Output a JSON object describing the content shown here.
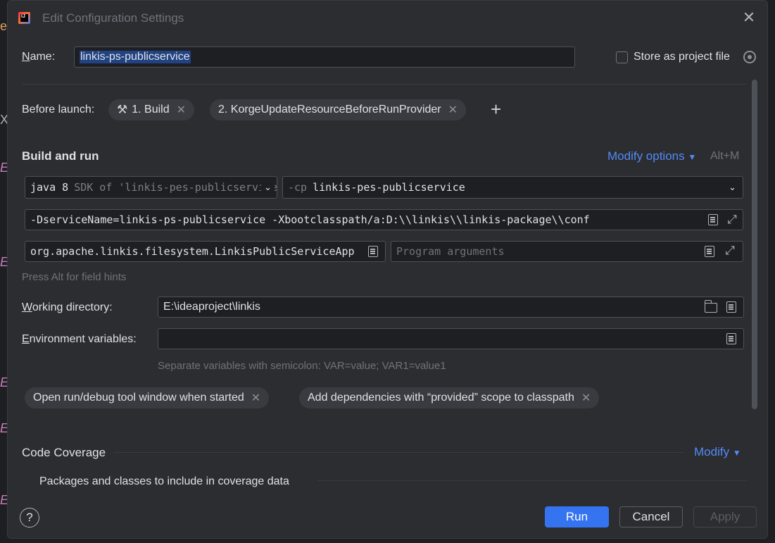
{
  "dialog": {
    "title": "Edit Configuration Settings"
  },
  "name_row": {
    "label": "Name:",
    "value": "linkis-ps-publicservice",
    "store_label": "Store as project file"
  },
  "before_launch": {
    "label": "Before launch:",
    "tasks": [
      {
        "label": "1. Build"
      },
      {
        "label": "2. KorgeUpdateResourceBeforeRunProvider"
      }
    ]
  },
  "build_and_run": {
    "title": "Build and run",
    "modify_options": "Modify options",
    "shortcut": "Alt+M",
    "jdk_primary": "java 8",
    "jdk_secondary": "SDK of 'linkis-pes-publicservice'",
    "cp_flag": "-cp",
    "cp_value": "linkis-pes-publicservice",
    "vm_options": "-DserviceName=linkis-ps-publicservice -Xbootclasspath/a:D:\\\\linkis\\\\linkis-package\\\\conf",
    "main_class": "org.apache.linkis.filesystem.LinkisPublicServiceApp",
    "program_args_placeholder": "Program arguments",
    "field_hint": "Press Alt for field hints"
  },
  "working_dir": {
    "label": "Working directory:",
    "value": "E:\\ideaproject\\linkis"
  },
  "env_vars": {
    "label": "Environment variables:",
    "value": "",
    "hint": "Separate variables with semicolon: VAR=value; VAR1=value1"
  },
  "options": [
    {
      "label": "Open run/debug tool window when started"
    },
    {
      "label": "Add dependencies with “provided” scope to classpath"
    }
  ],
  "coverage": {
    "title": "Code Coverage",
    "modify": "Modify",
    "packages_label": "Packages and classes to include in coverage data"
  },
  "footer": {
    "help": "?",
    "run": "Run",
    "cancel": "Cancel",
    "apply": "Apply"
  },
  "colors": {
    "accent": "#3574f0",
    "link": "#548af7",
    "background": "#2b2d30"
  }
}
